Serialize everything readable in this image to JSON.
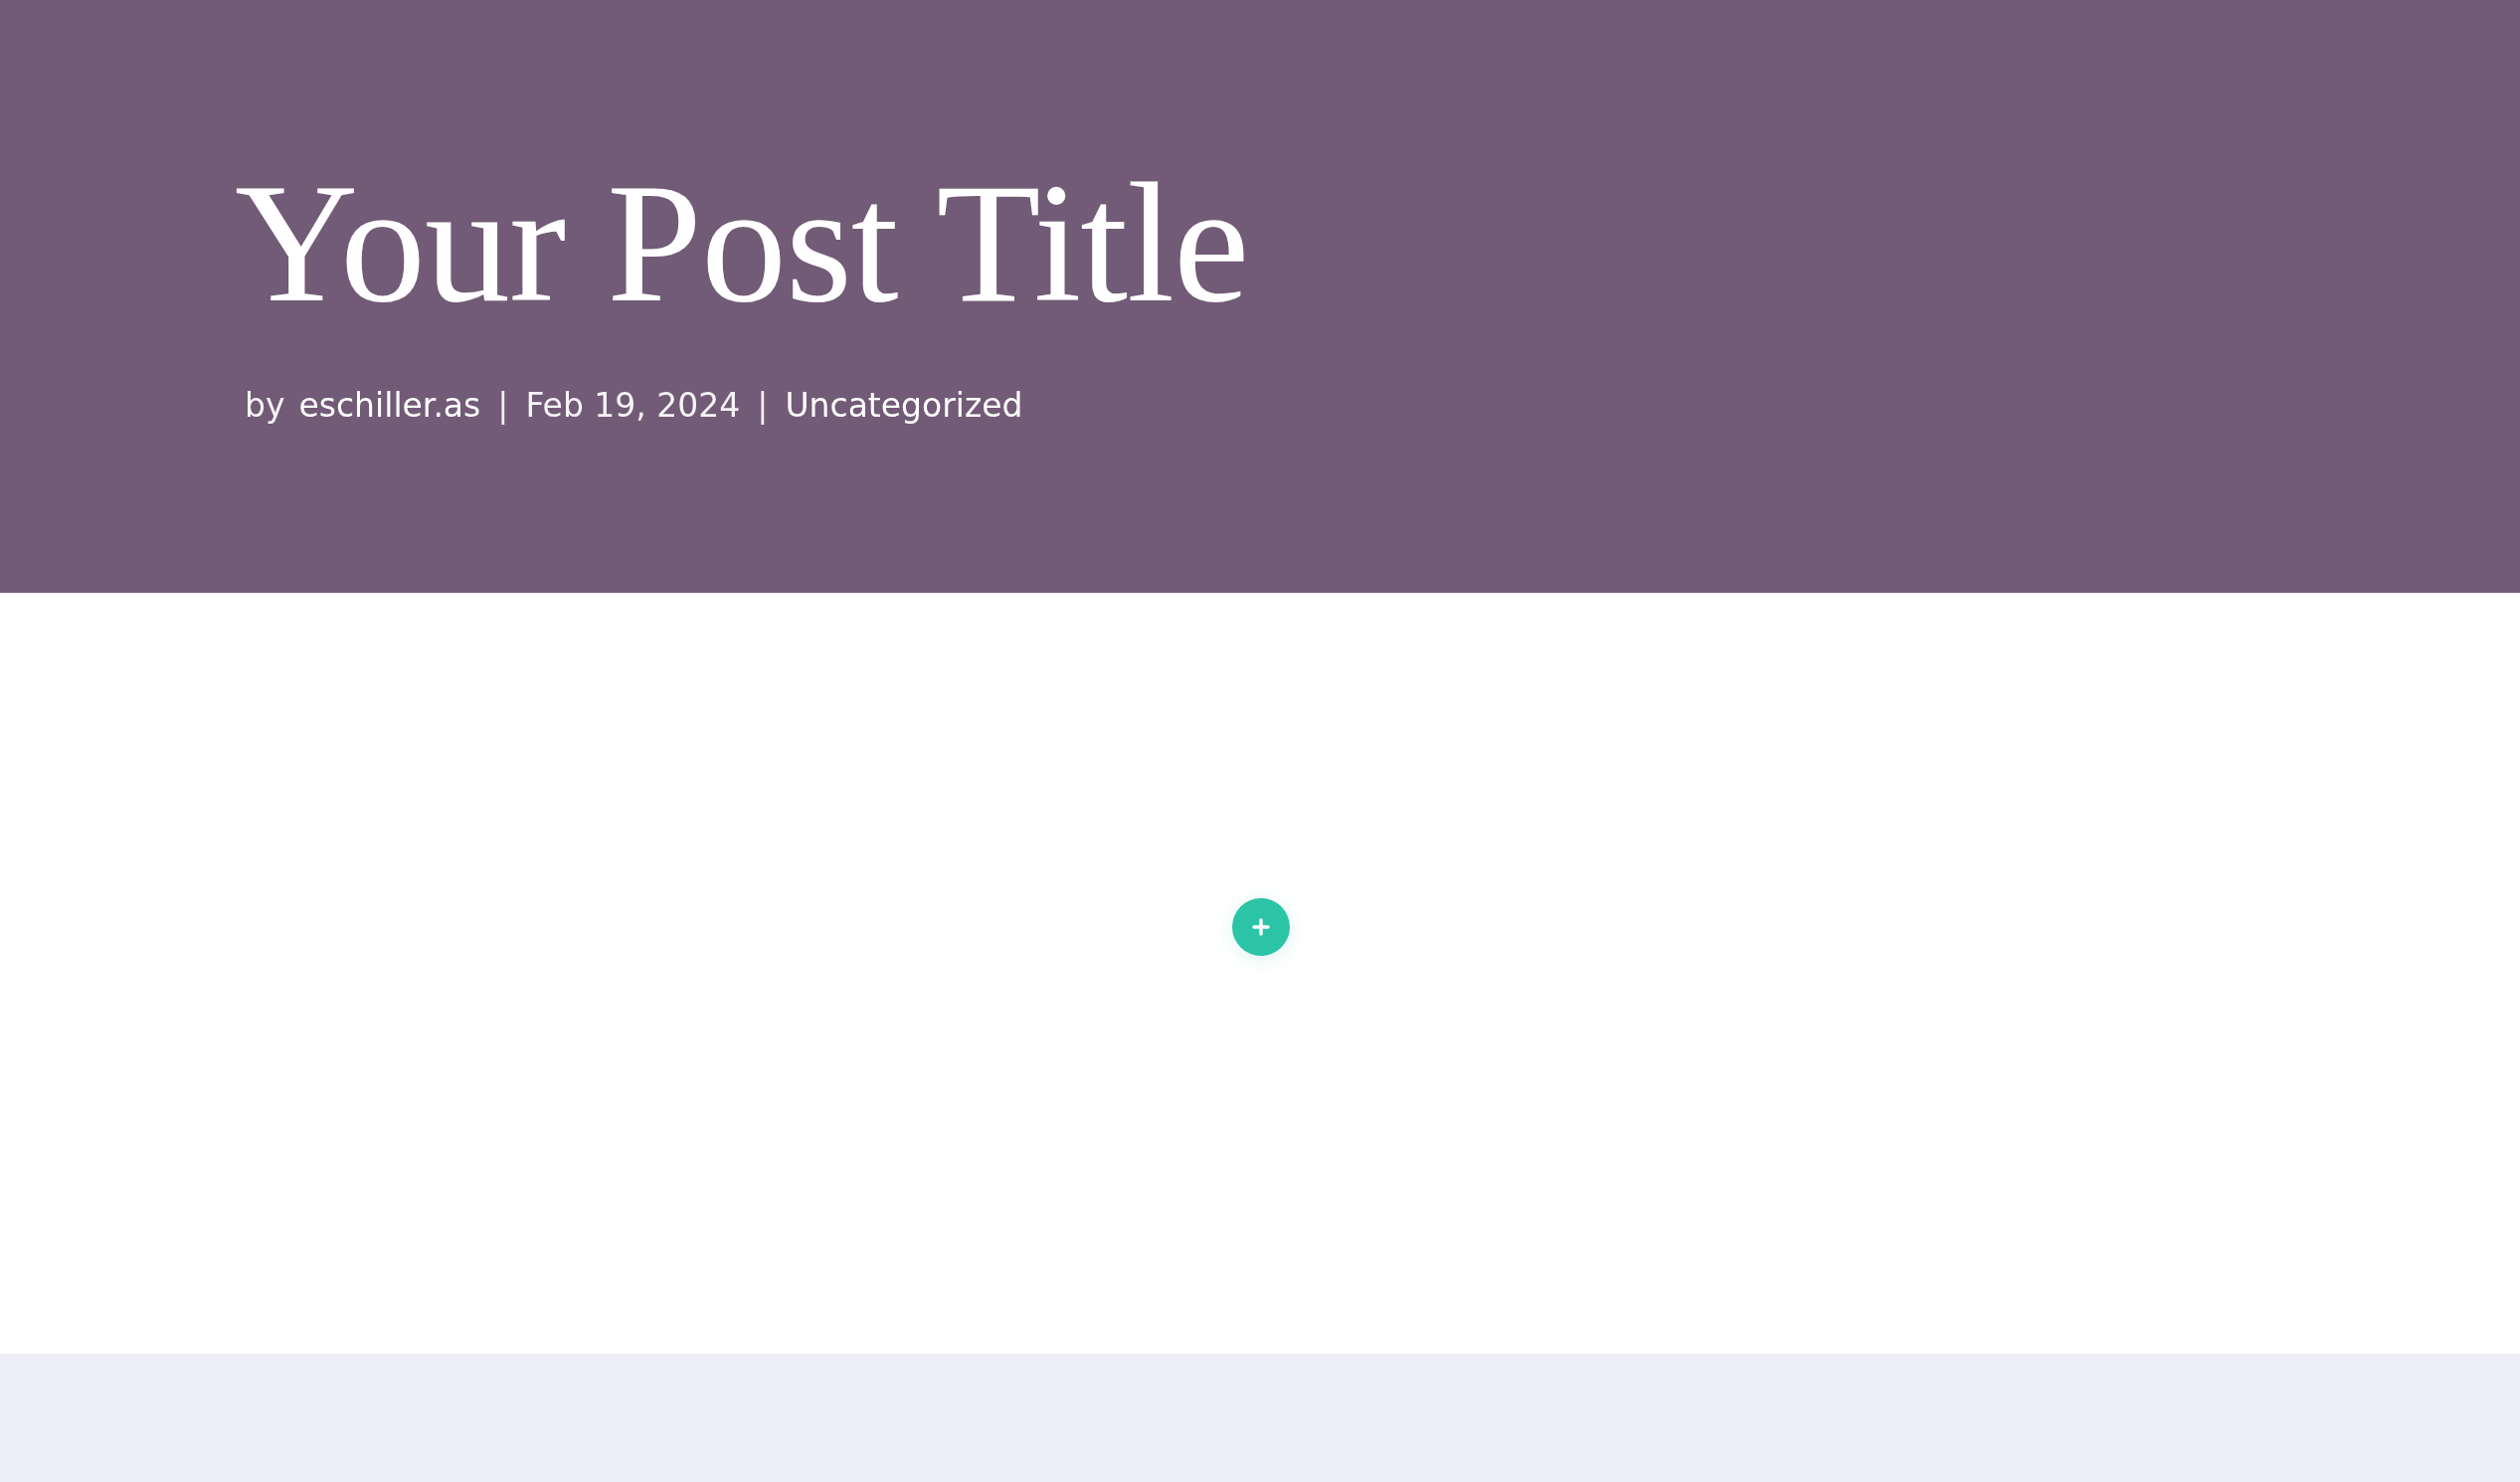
{
  "header": {
    "title": "Your Post Title",
    "meta": [
      {
        "kind": "text",
        "text": "by"
      },
      {
        "kind": "link",
        "text": "eschiller.as"
      },
      {
        "kind": "separator",
        "text": "|"
      },
      {
        "kind": "text",
        "text": "Feb 19, 2024"
      },
      {
        "kind": "separator",
        "text": "|"
      },
      {
        "kind": "link",
        "text": "Uncategorized"
      }
    ]
  },
  "content": {
    "add_button": {
      "kind": "add"
    }
  }
}
